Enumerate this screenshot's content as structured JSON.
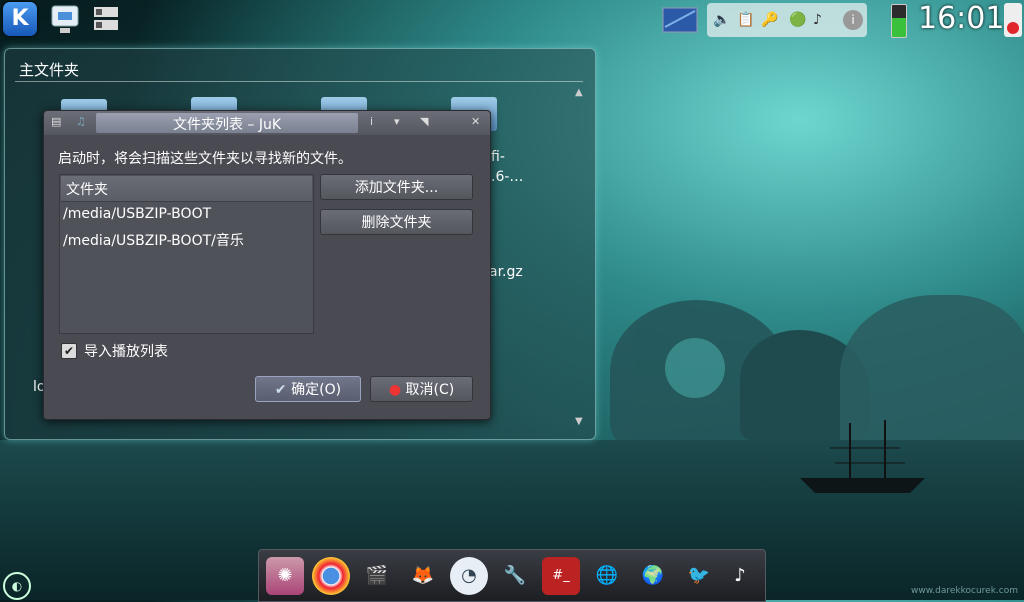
{
  "clock": "16:01",
  "watermark": "www.darekkocurek.com",
  "folderview": {
    "title": "主文件夹",
    "bg_label_right1": "fi-",
    "bg_label_right2": ".6-…",
    "bg_label_right3": "ar.gz",
    "bg_label_left": "lo"
  },
  "dialog": {
    "title": "文件夹列表 – JuK",
    "description": "启动时，将会扫描这些文件夹以寻找新的文件。",
    "list_header": "文件夹",
    "folders": [
      "/media/USBZIP-BOOT",
      "/media/USBZIP-BOOT/音乐"
    ],
    "add_button": "添加文件夹...",
    "remove_button": "删除文件夹",
    "import_checkbox_label": "导入播放列表",
    "import_checked": true,
    "ok_button": "确定(O)",
    "cancel_button": "取消(C)"
  },
  "dock": {
    "icons": [
      "settings-icon",
      "chrome-icon",
      "video-editor-icon",
      "gimp-icon",
      "clock-icon",
      "tools-icon",
      "terminal-icon",
      "network-icon",
      "globe-icon",
      "pidgin-icon",
      "amarok-icon"
    ]
  },
  "colors": {
    "accent": "#4a9bef",
    "dialog_bg": "#4a4a52",
    "battery": "#39c13b"
  }
}
